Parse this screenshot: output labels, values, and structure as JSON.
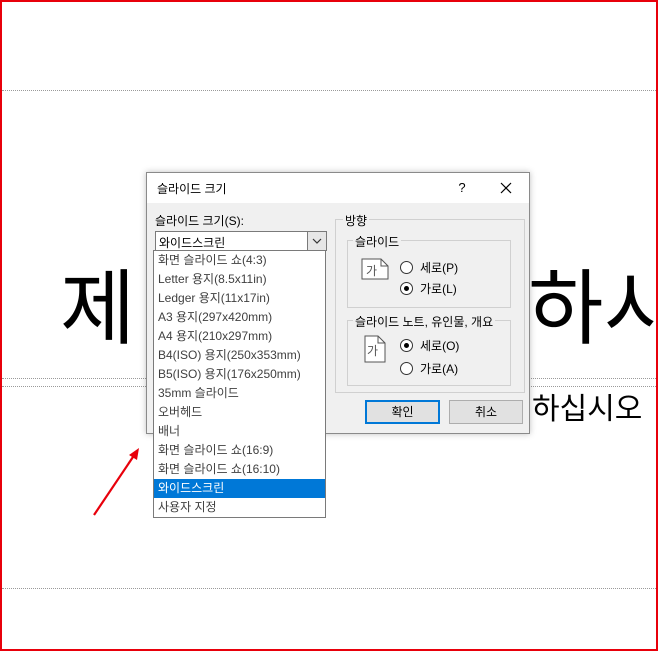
{
  "slide": {
    "title_left": "제",
    "title_right": "하시",
    "subtitle_right": "하십시오"
  },
  "dialog": {
    "title": "슬라이드 크기",
    "help_label": "?",
    "close_icon": "close-icon",
    "size_label": "슬라이드 크기(S):",
    "selected_value": "와이드스크린",
    "size_options": [
      "화면 슬라이드 쇼(4:3)",
      "Letter 용지(8.5x11in)",
      "Ledger 용지(11x17in)",
      "A3 용지(297x420mm)",
      "A4 용지(210x297mm)",
      "B4(ISO) 용지(250x353mm)",
      "B5(ISO) 용지(176x250mm)",
      "35mm 슬라이드",
      "오버헤드",
      "배너",
      "화면 슬라이드 쇼(16:9)",
      "화면 슬라이드 쇼(16:10)",
      "와이드스크린",
      "사용자 지정"
    ],
    "selected_index": 12,
    "orientation_label": "방향",
    "slides_group_label": "슬라이드",
    "slides_portrait": "세로(P)",
    "slides_landscape": "가로(L)",
    "slides_landscape_checked": true,
    "notes_group_label": "슬라이드 노트, 유인물, 개요",
    "notes_portrait": "세로(O)",
    "notes_landscape": "가로(A)",
    "notes_portrait_checked": true,
    "icon_glyph": "가",
    "ok_label": "확인",
    "cancel_label": "취소"
  },
  "colors": {
    "frame": "#e8000b",
    "selection": "#0078d7",
    "arrow": "#e8000b"
  }
}
